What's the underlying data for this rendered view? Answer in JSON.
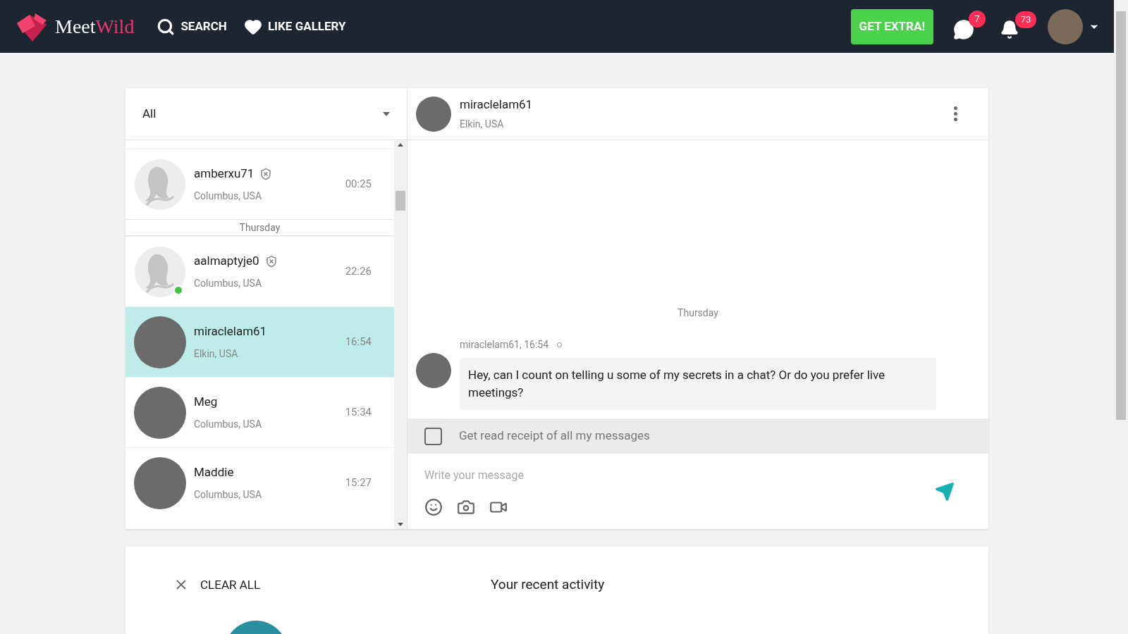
{
  "header": {
    "logo": {
      "part1": "Meet",
      "part2": "Wild"
    },
    "nav": [
      {
        "label": "SEARCH",
        "kind": "search"
      },
      {
        "label": "LIKE GALLERY",
        "kind": "heart"
      }
    ],
    "extra_button": "GET EXTRA!",
    "messages_badge": "7",
    "notifications_badge": "73"
  },
  "filter": {
    "value": "All"
  },
  "conversations": [
    {
      "kind": "contact",
      "name": "amberxu71",
      "location": "Columbus, USA",
      "time": "00:25",
      "verified": true,
      "online": false,
      "selected": false,
      "avatar": {
        "kind": "silhouette"
      }
    },
    {
      "kind": "separator",
      "label": "Thursday"
    },
    {
      "kind": "contact",
      "name": "aalmaptyje0",
      "location": "Columbus, USA",
      "time": "22:26",
      "verified": true,
      "online": true,
      "selected": false,
      "avatar": {
        "kind": "silhouette"
      }
    },
    {
      "kind": "contact",
      "name": "miraclelam61",
      "location": "Elkin, USA",
      "time": "16:54",
      "verified": false,
      "online": false,
      "selected": true,
      "avatar": {
        "kind": "photo"
      }
    },
    {
      "kind": "contact",
      "name": "Meg",
      "location": "Columbus, USA",
      "time": "15:34",
      "verified": false,
      "online": false,
      "selected": false,
      "avatar": {
        "kind": "photo"
      }
    },
    {
      "kind": "contact",
      "name": "Maddie",
      "location": "Columbus, USA",
      "time": "15:27",
      "verified": false,
      "online": false,
      "selected": false,
      "avatar": {
        "kind": "photo"
      }
    }
  ],
  "chat": {
    "name": "miraclelam61",
    "location": "Elkin, USA",
    "day": "Thursday",
    "messages": [
      {
        "meta": "miraclelam61, 16:54",
        "text": "Hey, can I count on telling u some of my secrets in a chat? Or do you prefer live meetings?"
      }
    ],
    "read_receipt": {
      "label": "Get read receipt of all my messages",
      "checked": false
    },
    "composer": {
      "placeholder": "Write your message"
    }
  },
  "activity": {
    "clear_all": "CLEAR ALL",
    "title": "Your recent activity"
  }
}
